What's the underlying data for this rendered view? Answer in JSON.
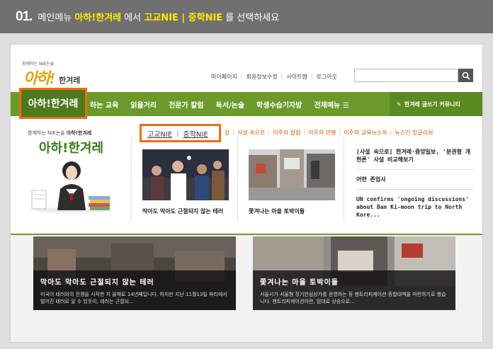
{
  "instruction": {
    "step": "01.",
    "prefix": "메인메뉴 ",
    "menu": "아하!한겨레",
    "mid": " 에서 ",
    "target": "고교NIE | 중학NIE",
    "suffix": " 를 선택하세요"
  },
  "site": {
    "logo": {
      "sub": "함께하는 NIE논술",
      "main": "아하!",
      "brand": "한겨레"
    },
    "util": [
      "마이페이지",
      "회원정보수정",
      "사이트맵",
      "로그아웃"
    ],
    "search_icon": "search-icon"
  },
  "nav": {
    "first": "아하!한겨레",
    "items": [
      "하는 교육",
      "읽을거리",
      "전문가 칼럼",
      "독서/논술",
      "학생수습기자방",
      "전체메뉴 ☰"
    ],
    "community": "한겨레 글쓰기 커뮤니티"
  },
  "promo": {
    "line1_pre": "함께하는 NIE논술 ",
    "line1_bold": "아하!한겨레",
    "title": "아하!한겨레"
  },
  "subtabs": {
    "tab1": "고교NIE",
    "tab2": "중학NIE",
    "partial": "상",
    "rest": [
      "사설 속으로",
      "이주의 칼럼",
      "이주의 만평",
      "이주의 교육뉴스쏙",
      "뉴스인 잉글리쉬"
    ]
  },
  "cards": [
    {
      "caption": "막아도 막아도 근절되지 않는 테러"
    },
    {
      "caption": "쫓겨나는 마을 토박이들"
    }
  ],
  "headlines": [
    "[사설 속으로] 한겨레·중앙일보, '분권형 개헌론' 사설 비교해보기",
    "어떤 존엄사",
    "UN confirms 'ongoing discussions' about Ban Ki-moon trip to North Kore..."
  ],
  "features": [
    {
      "title": "막아도 막아도 근절되지 않는 테러",
      "desc": "미국이 테러와의 전쟁을 시작한 지 올해로 14년째입니다. 하지만 지난 11월13일 파리에서 벌어진 테러로 알 수 있듯이, 테러는 근절되..."
    },
    {
      "title": "쫓겨나는 마을 토박이들",
      "desc": "서울시가 서울형 장기안심상가를 운영하는 등 젠트리피케이션 종합대책을 마련하기로 했습니다. 젠트리피케이션이란, 임대료 상승으로..."
    }
  ],
  "colors": {
    "nav": "#6b9a2a",
    "highlight": "#f26b11",
    "header": "#707070",
    "accent": "#ffea00"
  }
}
